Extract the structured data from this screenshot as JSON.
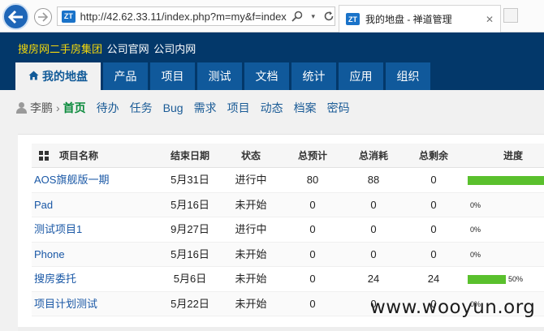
{
  "browser": {
    "url": "http://42.62.33.11/index.php?m=my&f=index",
    "tab_title": "我的地盘 - 禅道管理",
    "site_badge": "ZT"
  },
  "header": {
    "brand": "搜房网二手房集团",
    "links": [
      "公司官网",
      "公司内网"
    ]
  },
  "main_nav": [
    {
      "label": "我的地盘",
      "active": true
    },
    {
      "label": "产品"
    },
    {
      "label": "项目"
    },
    {
      "label": "测试"
    },
    {
      "label": "文档"
    },
    {
      "label": "统计"
    },
    {
      "label": "应用"
    },
    {
      "label": "组织"
    }
  ],
  "sub_nav": {
    "user": "李鹏",
    "items": [
      {
        "label": "首页",
        "active": true
      },
      {
        "label": "待办"
      },
      {
        "label": "任务"
      },
      {
        "label": "Bug"
      },
      {
        "label": "需求"
      },
      {
        "label": "项目"
      },
      {
        "label": "动态"
      },
      {
        "label": "档案"
      },
      {
        "label": "密码"
      }
    ]
  },
  "table": {
    "headers": {
      "name": "项目名称",
      "end": "结束日期",
      "status": "状态",
      "estimate": "总预计",
      "consumed": "总消耗",
      "left": "总剩余",
      "progress": "进度"
    },
    "rows": [
      {
        "name": "AOS旗舰版一期",
        "end": "5月31日",
        "status": "进行中",
        "estimate": "80",
        "consumed": "88",
        "left": "0",
        "progress": 100,
        "progress_label": ""
      },
      {
        "name": "Pad",
        "end": "5月16日",
        "status": "未开始",
        "estimate": "0",
        "consumed": "0",
        "left": "0",
        "progress": 0,
        "progress_label": "0%"
      },
      {
        "name": "测试项目1",
        "end": "9月27日",
        "status": "进行中",
        "estimate": "0",
        "consumed": "0",
        "left": "0",
        "progress": 0,
        "progress_label": "0%"
      },
      {
        "name": "Phone",
        "end": "5月16日",
        "status": "未开始",
        "estimate": "0",
        "consumed": "0",
        "left": "0",
        "progress": 0,
        "progress_label": "0%"
      },
      {
        "name": "搜房委托",
        "end": "5月6日",
        "status": "未开始",
        "estimate": "0",
        "consumed": "24",
        "left": "24",
        "progress": 50,
        "progress_label": "50%"
      },
      {
        "name": "项目计划测试",
        "end": "5月22日",
        "status": "未开始",
        "estimate": "0",
        "consumed": "0",
        "left": "0",
        "progress": 0,
        "progress_label": "0%"
      }
    ]
  },
  "watermark": "www.wooyun.org",
  "colors": {
    "header_bg": "#03386a",
    "nav_bg": "#10599b",
    "brand": "#f5d90a",
    "progress": "#5ac02d",
    "link": "#1a58a6"
  }
}
